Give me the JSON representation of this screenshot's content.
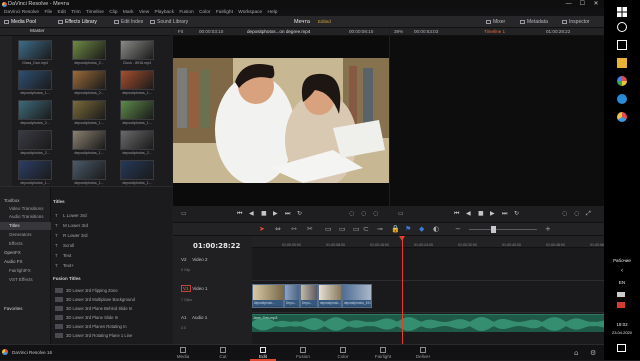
{
  "window": {
    "app_title": "DaVinci Resolve - Мечта",
    "menu": [
      "DaVinci Resolve",
      "File",
      "Edit",
      "Trim",
      "Timeline",
      "Clip",
      "Mark",
      "View",
      "Playback",
      "Fusion",
      "Color",
      "Fairlight",
      "Workspace",
      "Help"
    ],
    "minimize": "—",
    "maximize": "☐",
    "close": "✕"
  },
  "toolbar": {
    "media_pool": "Media Pool",
    "effects_library": "Effects Library",
    "edit_index": "Edit Index",
    "sound_library": "Sound Library",
    "project_title": "Мечта",
    "project_status": "Edited",
    "mixer": "Mixer",
    "metadata": "Metadata",
    "inspector": "Inspector"
  },
  "media_pool": {
    "bin": "Master",
    "clips": [
      {
        "name": "Glass_Dan.mp4",
        "color": "#3d6c8a"
      },
      {
        "name": "depositphotos_2...",
        "color": "#6f8a43"
      },
      {
        "name": "Clock - 8916.mp4",
        "color": "#8a8a86"
      },
      {
        "name": "depositphotos_1...",
        "color": "#2f4f73"
      },
      {
        "name": "depositphotos_2...",
        "color": "#9a6a3a"
      },
      {
        "name": "depositphotos_1...",
        "color": "#a64e2e"
      },
      {
        "name": "depositphotos_2...",
        "color": "#3e6a7a"
      },
      {
        "name": "depositphotos_1...",
        "color": "#7a6a3a"
      },
      {
        "name": "depositphotos_1...",
        "color": "#5e8a4a"
      },
      {
        "name": "depositphotos_2...",
        "color": "#3a3a44"
      },
      {
        "name": "depositphotos_1...",
        "color": "#8a8070"
      },
      {
        "name": "depositphotos_2...",
        "color": "#6a6a6a"
      },
      {
        "name": "depositphotos_1...",
        "color": "#2c3e66"
      },
      {
        "name": "depositphotos_1...",
        "color": "#4a5a6a"
      },
      {
        "name": "depositphotos_1...",
        "color": "#24395a"
      }
    ]
  },
  "toolbox": {
    "items": [
      "Toolbox",
      "Video Transitions",
      "Audio Transitions",
      "Titles",
      "Generators",
      "Effects",
      "OpenFX",
      "Audio FX",
      "FairlightFX",
      "VST Effects"
    ],
    "selected": "Titles",
    "favorites": "Favorites"
  },
  "titles": {
    "header": "Titles",
    "items": [
      "L Lower 3rd",
      "M Lower 3rd",
      "R Lower 3rd",
      "Scroll",
      "Text",
      "Text+"
    ],
    "fusion_header": "Fusion Titles",
    "fusion_items": [
      "3D Lower 3rd Flipping Zone",
      "3D Lower 3rd Multiplane Background",
      "3D Lower 3rd Plane Behind Slide In",
      "3D Lower 3rd Plane Slide In",
      "3D Lower 3rd Planes Rotating In",
      "3D Lower 3rd Rotating Plane 1 Line"
    ]
  },
  "source_viewer": {
    "fit": "Fit",
    "timecode_in": "00:00:03:10",
    "clip_name": "depositphotos...on degree.mp4",
    "timecode_out": "00:00:08:10",
    "video_colors": {
      "wall": "#c7b893",
      "shelf": "#6b5432",
      "shirt_man": "#f2f2f0",
      "shirt_woman": "#d9c8b2",
      "skin": "#d9a27f",
      "hair": "#1e1612"
    }
  },
  "record_viewer": {
    "zoom": "39%",
    "timecode": "00:00:53:03",
    "timeline_name": "Timeline 1",
    "timecode_current": "01:00:28:22"
  },
  "timeline": {
    "timecode": "01:00:28:22",
    "tracks": [
      {
        "id": "V2",
        "name": "Video 2",
        "clips_label": "0 Clip"
      },
      {
        "id": "V1",
        "name": "Video 1",
        "clips_label": "7 Clips"
      },
      {
        "id": "A1",
        "name": "Audio 1",
        "clips_label": "2.0"
      }
    ],
    "ruler_ticks": [
      "01:00:00:00",
      "01:00:08:00",
      "01:00:16:00",
      "01:00:24:00",
      "01:00:32:00",
      "01:00:40:00",
      "01:00:48:00",
      "01:00:56:00"
    ],
    "video_clips": [
      "depositphoto...",
      "Depo...",
      "Depo...",
      "depositphoto...",
      "depositphotos_1913..."
    ],
    "audio_clip": "Jane_Dan.mp3"
  },
  "pages": {
    "brand": "DaVinci Resolve 16",
    "tabs": [
      "Media",
      "Cut",
      "Edit",
      "Fusion",
      "Color",
      "Fairlight",
      "Deliver"
    ],
    "active": "Edit"
  },
  "taskbar": {
    "desktop_label": "Рабочие",
    "lang": "EN",
    "time": "19:02",
    "date": "23.04.2020"
  },
  "colors": {
    "accent": "#e44b35",
    "audio_clip": "#1f5a48",
    "video_clip": "#2e4866"
  }
}
